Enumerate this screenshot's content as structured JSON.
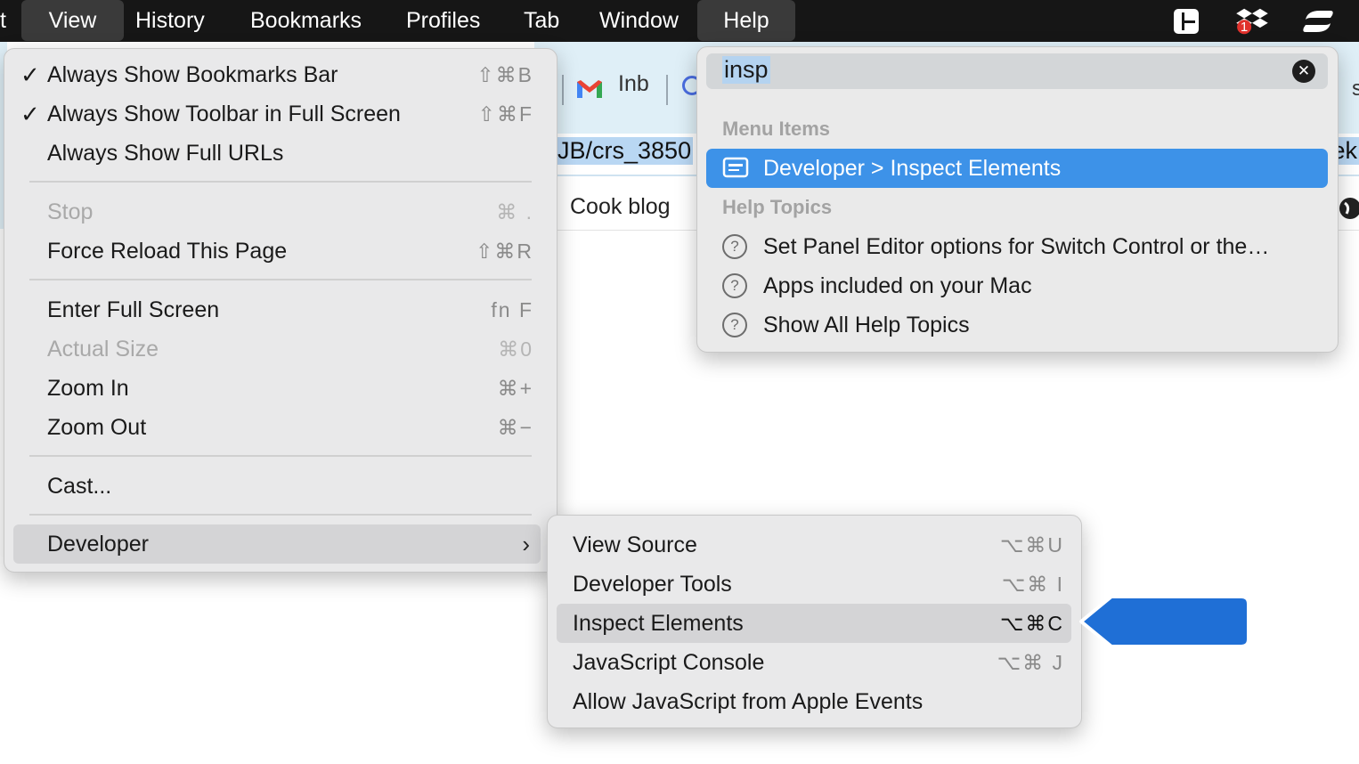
{
  "menubar": {
    "items": [
      {
        "label": "t"
      },
      {
        "label": "View"
      },
      {
        "label": "History"
      },
      {
        "label": "Bookmarks"
      },
      {
        "label": "Profiles"
      },
      {
        "label": "Tab"
      },
      {
        "label": "Window"
      },
      {
        "label": "Help"
      }
    ],
    "status_icons": [
      "window-layout-icon",
      "dropbox-icon",
      "sync-icon"
    ],
    "dropbox_badge": "1"
  },
  "browser": {
    "tab_gmail_label": "Inb",
    "url_text": "JB/crs_3850",
    "url_right": "ek",
    "bookmark_label": "Cook blog",
    "right_partial": "s"
  },
  "view_menu": {
    "items": [
      {
        "check": "✓",
        "label": "Always Show Bookmarks Bar",
        "shortcut": "⇧⌘B"
      },
      {
        "check": "✓",
        "label": "Always Show Toolbar in Full Screen",
        "shortcut": "⇧⌘F"
      },
      {
        "check": "",
        "label": "Always Show Full URLs",
        "shortcut": ""
      },
      {
        "check": "",
        "label": "Stop",
        "shortcut": "⌘ ."
      },
      {
        "check": "",
        "label": "Force Reload This Page",
        "shortcut": "⇧⌘R"
      },
      {
        "check": "",
        "label": "Enter Full Screen",
        "shortcut": "fn F"
      },
      {
        "check": "",
        "label": "Actual Size",
        "shortcut": "⌘0"
      },
      {
        "check": "",
        "label": "Zoom In",
        "shortcut": "⌘+"
      },
      {
        "check": "",
        "label": "Zoom Out",
        "shortcut": "⌘−"
      },
      {
        "check": "",
        "label": "Cast...",
        "shortcut": ""
      },
      {
        "check": "",
        "label": "Developer",
        "shortcut": "›"
      }
    ]
  },
  "developer_menu": {
    "items": [
      {
        "label": "View Source",
        "shortcut": "⌥⌘U"
      },
      {
        "label": "Developer Tools",
        "shortcut": "⌥⌘ I"
      },
      {
        "label": "Inspect Elements",
        "shortcut": "⌥⌘C"
      },
      {
        "label": "JavaScript Console",
        "shortcut": "⌥⌘ J"
      },
      {
        "label": "Allow JavaScript from Apple Events",
        "shortcut": ""
      }
    ]
  },
  "help_panel": {
    "search_value": "insp",
    "clear_icon": "✕",
    "section_menu_items": "Menu Items",
    "section_help_topics": "Help Topics",
    "menu_results": [
      {
        "label": "Developer > Inspect Elements"
      }
    ],
    "help_topics": [
      {
        "label": "Set Panel Editor options for Switch Control or the…"
      },
      {
        "label": "Apps included on your Mac"
      },
      {
        "label": "Show All Help Topics"
      }
    ],
    "help_icon_glyph": "?"
  },
  "colors": {
    "selection_blue": "#3d92e8",
    "callout_blue": "#1f6fd6",
    "menubar": "#161616"
  }
}
